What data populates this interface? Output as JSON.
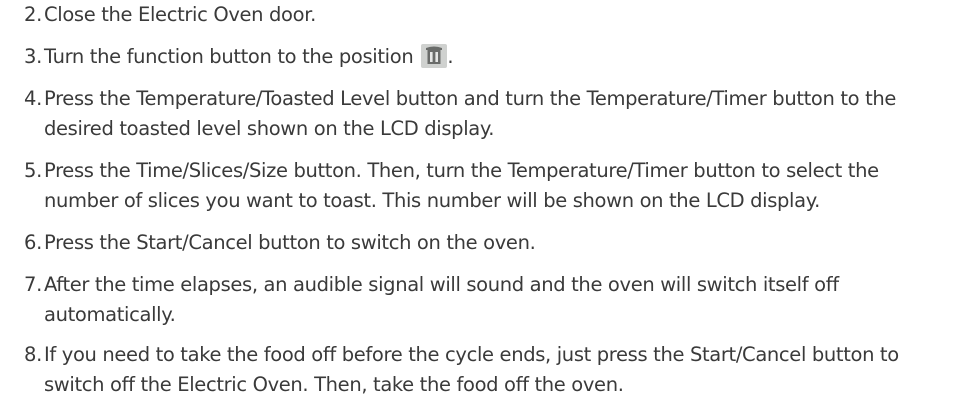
{
  "steps": [
    {
      "number": "2.",
      "lines": [
        "Close the Electric Oven door."
      ]
    },
    {
      "number": "3.",
      "lines": [
        "Turn the function button to the position",
        "."
      ],
      "icon": "toast-function-icon"
    },
    {
      "number": "4.",
      "lines": [
        "Press the Temperature/Toasted Level button and turn the Temperature/Timer button to the",
        "desired toasted level shown on the LCD display."
      ]
    },
    {
      "number": "5.",
      "lines": [
        "Press the Time/Slices/Size button. Then, turn the Temperature/Timer button to select the",
        "number of slices you want to toast. This number will be shown on the LCD display."
      ]
    },
    {
      "number": "6.",
      "lines": [
        "Press the Start/Cancel button to switch on the oven."
      ]
    },
    {
      "number": "7.",
      "lines": [
        "After the time elapses, an audible signal will sound and the oven will switch itself off",
        "automatically."
      ]
    },
    {
      "number": "8.",
      "lines": [
        "If you need to take the food off before the cycle ends, just press the Start/Cancel button to",
        "switch off the Electric Oven. Then, take the food off the oven."
      ]
    }
  ],
  "colors": {
    "text": "#3a3a3a",
    "icon_bg": "#c9cbc9",
    "icon_fg": "#6a6c6a"
  }
}
